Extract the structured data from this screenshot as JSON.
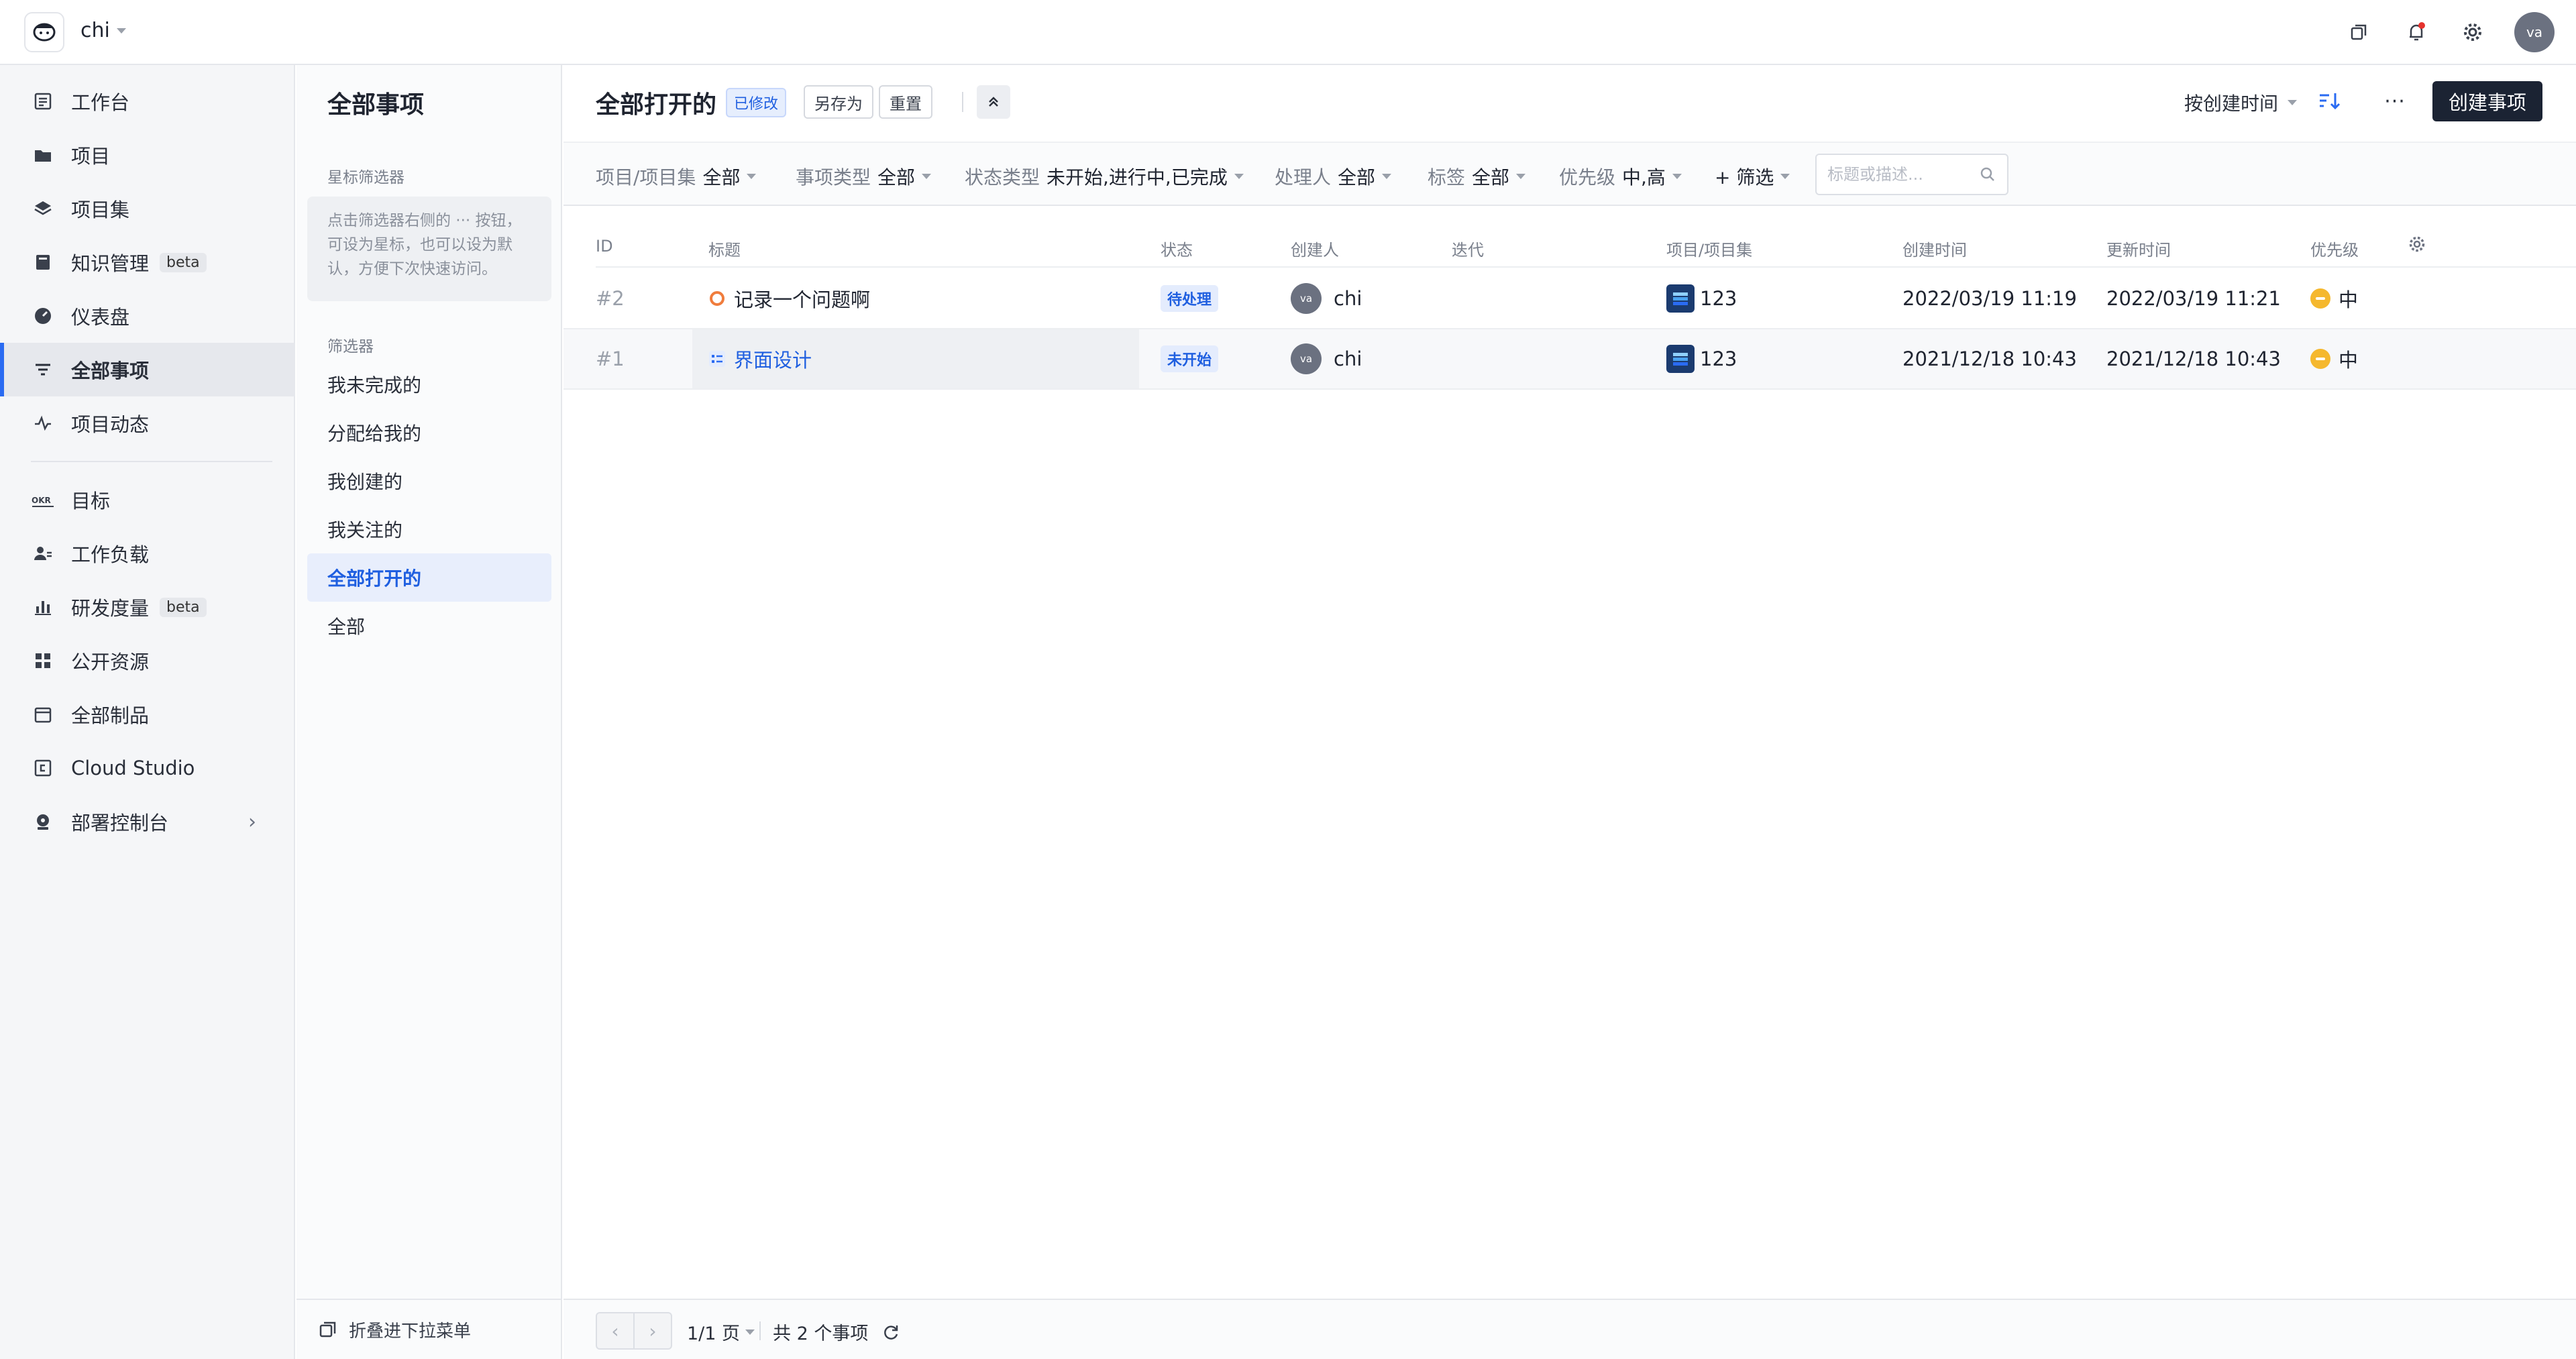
{
  "topbar": {
    "team_name": "chi",
    "avatar_initials": "va",
    "icons": [
      "window-icon",
      "bell-icon",
      "gear-icon"
    ]
  },
  "nav": {
    "items": [
      {
        "label": "工作台",
        "icon": "workbench-icon"
      },
      {
        "label": "项目",
        "icon": "folder-icon"
      },
      {
        "label": "项目集",
        "icon": "layers-icon"
      },
      {
        "label": "知识管理",
        "icon": "book-icon",
        "badge": "beta"
      },
      {
        "label": "仪表盘",
        "icon": "dashboard-icon"
      },
      {
        "label": "全部事项",
        "icon": "filter-list-icon",
        "active": true
      },
      {
        "label": "项目动态",
        "icon": "activity-icon"
      },
      {
        "label": "目标",
        "icon": "okr-icon"
      },
      {
        "label": "工作负载",
        "icon": "workload-icon"
      },
      {
        "label": "研发度量",
        "icon": "bar-chart-icon",
        "badge": "beta"
      },
      {
        "label": "公开资源",
        "icon": "grid-icon"
      },
      {
        "label": "全部制品",
        "icon": "package-icon"
      },
      {
        "label": "Cloud Studio",
        "icon": "cloud-studio-icon"
      },
      {
        "label": "部署控制台",
        "icon": "deploy-icon"
      }
    ]
  },
  "filter_panel": {
    "title": "全部事项",
    "starred_section": "星标筛选器",
    "starred_hint": "点击筛选器右侧的 ··· 按钮，可设为星标，也可以设为默认，方便下次快速访问。",
    "filters_section": "筛选器",
    "filters": [
      "我未完成的",
      "分配给我的",
      "我创建的",
      "我关注的",
      "全部打开的",
      "全部"
    ],
    "active_filter": "全部打开的",
    "collapse_label": "折叠进下拉菜单"
  },
  "main": {
    "view_title": "全部打开的",
    "modified_badge": "已修改",
    "save_as": "另存为",
    "reset": "重置",
    "sort_label": "按创建时间",
    "create_label": "创建事项",
    "more_label": "···"
  },
  "filters_bar": {
    "chips": [
      {
        "key": "项目/项目集",
        "value": "全部"
      },
      {
        "key": "事项类型",
        "value": "全部"
      },
      {
        "key": "状态类型",
        "value": "未开始,进行中,已完成"
      },
      {
        "key": "处理人",
        "value": "全部"
      },
      {
        "key": "标签",
        "value": "全部"
      },
      {
        "key": "优先级",
        "value": "中,高"
      }
    ],
    "add_filter": "+ 筛选",
    "search_placeholder": "标题或描述..."
  },
  "table": {
    "columns": [
      "ID",
      "标题",
      "状态",
      "创建人",
      "迭代",
      "项目/项目集",
      "创建时间",
      "更新时间",
      "优先级"
    ],
    "rows": [
      {
        "id": "#2",
        "title": "记录一个问题啊",
        "type_icon": "bug-circle-icon",
        "status": "待处理",
        "creator_initials": "va",
        "creator": "chi",
        "iteration": "",
        "project": "123",
        "created": "2022/03/19 11:19",
        "updated": "2022/03/19 11:21",
        "priority": "中"
      },
      {
        "id": "#1",
        "title": "界面设计",
        "type_icon": "requirement-icon",
        "status": "未开始",
        "creator_initials": "va",
        "creator": "chi",
        "iteration": "",
        "project": "123",
        "created": "2021/12/18 10:43",
        "updated": "2021/12/18 10:43",
        "priority": "中"
      }
    ]
  },
  "footer": {
    "page_label": "1/1 页",
    "total_label": "共 2 个事项",
    "prev": "‹",
    "next": "›"
  },
  "colors": {
    "accent": "#2a6bf2",
    "primary_button": "#1b2333",
    "notification_dot": "#e5322d",
    "priority_medium": "#f5b82e",
    "bug_icon": "#f07c3c"
  }
}
